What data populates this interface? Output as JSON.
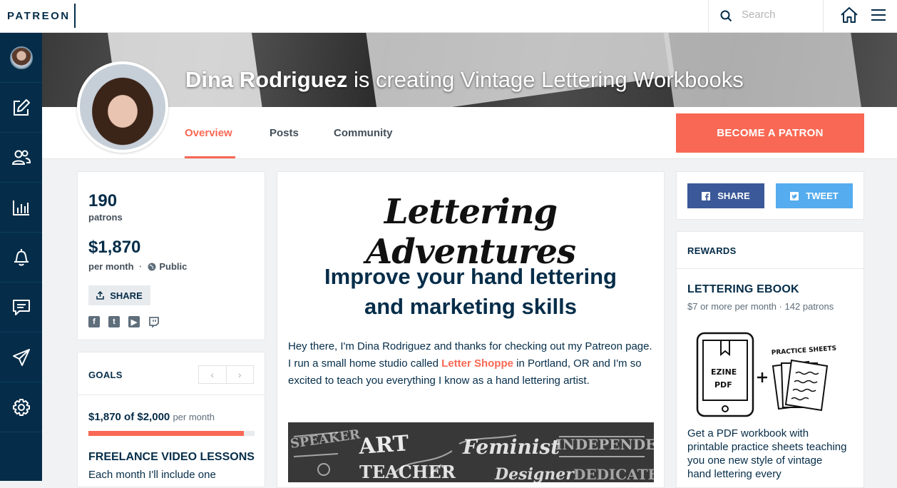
{
  "topbar": {
    "logo": "PATREON",
    "search_placeholder": "Search"
  },
  "sidebar": {
    "items": [
      {
        "icon": "avatar"
      },
      {
        "icon": "pencil-square-icon"
      },
      {
        "icon": "people-icon"
      },
      {
        "icon": "bar-chart-icon"
      },
      {
        "icon": "bell-icon"
      },
      {
        "icon": "chat-icon"
      },
      {
        "icon": "paper-plane-icon"
      },
      {
        "icon": "gear-icon"
      }
    ]
  },
  "banner": {
    "creator_name": "Dina Rodriguez",
    "tagline": " is creating Vintage Lettering Workbooks"
  },
  "tabs": [
    {
      "label": "Overview",
      "active": true
    },
    {
      "label": "Posts",
      "active": false
    },
    {
      "label": "Community",
      "active": false
    }
  ],
  "become_patron_label": "BECOME A PATRON",
  "stats": {
    "patrons_count": "190",
    "patrons_label": "patrons",
    "earnings": "$1,870",
    "earnings_label": "per month",
    "visibility": "Public",
    "share_label": "SHARE"
  },
  "goals": {
    "title": "GOALS",
    "prev": "‹",
    "next": "›",
    "amount": "$1,870 of $2,000",
    "amount_suffix": "per month",
    "progress_fraction": 0.935,
    "goal_name": "FREELANCE VIDEO LESSONS",
    "goal_desc": "Each month I'll include one"
  },
  "main": {
    "script_title": "Lettering Adventures",
    "headline_line1": "Improve your hand lettering",
    "headline_line2": "and marketing skills",
    "body_before_link": "Hey there, I'm Dina Rodriguez and thanks for checking out my Patreon page. I run a small home studio called ",
    "body_link": "Letter Shoppe",
    "body_after_link": " in Portland, OR and I'm so excited to teach you everything I know as a hand lettering artist."
  },
  "share_buttons": {
    "facebook": "SHARE",
    "twitter": "TWEET"
  },
  "rewards": {
    "title": "REWARDS",
    "reward_name": "LETTERING EBOOK",
    "reward_meta": "$7 or more per month · 142 patrons",
    "art_ezine": "EZINE",
    "art_pdf": "PDF",
    "art_practice": "PRACTICE SHEETS",
    "reward_desc": "Get a PDF workbook with printable practice sheets teaching you one new style of vintage hand lettering every"
  },
  "colors": {
    "navy": "#052d49",
    "coral": "#f96854",
    "facebook": "#3b5998",
    "twitter": "#55acee"
  }
}
